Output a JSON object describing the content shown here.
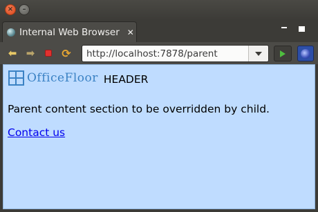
{
  "window": {
    "close_glyph": "×",
    "minimize_glyph": "–"
  },
  "tab": {
    "title": "Internal Web Browser",
    "close_glyph": "✕"
  },
  "toolbar": {
    "url": "http://localhost:7878/parent",
    "icons": [
      "back-icon",
      "forward-icon",
      "stop-icon",
      "refresh-icon",
      "dropdown-icon",
      "go-icon",
      "eclipse-icon"
    ]
  },
  "page": {
    "logo_text": "OfficeFloor",
    "header": "HEADER",
    "paragraph": "Parent content section to be overridden by child.",
    "link": "Contact us",
    "colors": {
      "background": "#bfdcff",
      "link": "#0000ee",
      "logo": "#3b82c4"
    }
  }
}
